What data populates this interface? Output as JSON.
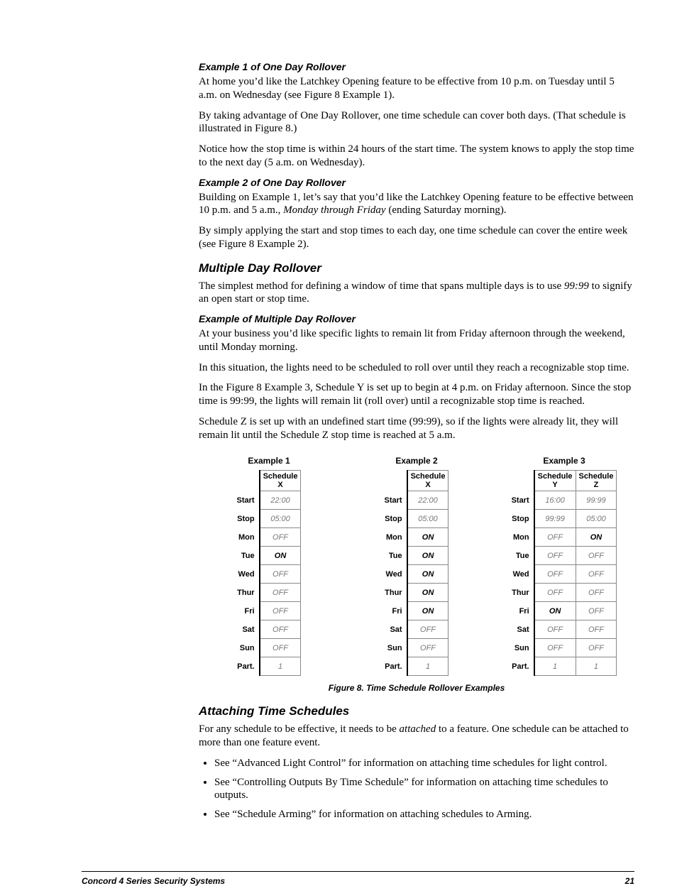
{
  "s1": {
    "h": "Example 1 of One Day Rollover",
    "p1": "At home you’d like the Latchkey Opening feature to be effective from 10 p.m. on Tuesday until 5 a.m. on Wednesday (see Figure 8 Example 1).",
    "p2": "By taking advantage of One Day Rollover, one time schedule can cover both days. (That schedule is illustrated in Figure 8.)",
    "p3": "Notice how the stop time is within 24 hours of the start time. The system knows to apply the stop time to the next day (5 a.m. on Wednesday)."
  },
  "s2": {
    "h": "Example 2 of One Day Rollover",
    "p1a": "Building on Example 1, let’s say that you’d like the Latchkey Opening feature to be effective between 10 p.m. and 5 a.m., ",
    "p1b": "Monday through Friday",
    "p1c": " (ending Saturday morning).",
    "p2": "By simply applying the start and stop times to each day, one time schedule can cover the entire week (see Figure 8 Example 2)."
  },
  "s3": {
    "h": "Multiple Day Rollover",
    "p1a": "The simplest method for defining a window of time that spans multiple days is to use ",
    "p1b": "99:99",
    "p1c": " to signify an open start or stop time."
  },
  "s4": {
    "h": "Example of Multiple Day Rollover",
    "p1": "At your business you’d like specific lights to remain lit from Friday afternoon through the weekend, until Monday morning.",
    "p2": "In this situation, the lights need to be scheduled to roll over until they reach a recognizable stop time.",
    "p3": "In the Figure 8 Example 3, Schedule Y is set up to begin at 4 p.m. on Friday afternoon. Since the stop time is 99:99, the lights will remain lit (roll over) until a recognizable stop time is reached.",
    "p4": "Schedule Z is set up with an undefined start time (99:99), so if the lights were already lit, they will remain lit until the Schedule Z stop time is reached at 5 a.m."
  },
  "rows": [
    "Start",
    "Stop",
    "Mon",
    "Tue",
    "Wed",
    "Thur",
    "Fri",
    "Sat",
    "Sun",
    "Part."
  ],
  "fig": {
    "ex1": {
      "title": "Example 1",
      "cols": [
        "Schedule X"
      ],
      "vals": [
        [
          {
            "t": "22:00",
            "c": "off"
          }
        ],
        [
          {
            "t": "05:00",
            "c": "off"
          }
        ],
        [
          {
            "t": "OFF",
            "c": "off"
          }
        ],
        [
          {
            "t": "ON",
            "c": "on"
          }
        ],
        [
          {
            "t": "OFF",
            "c": "off"
          }
        ],
        [
          {
            "t": "OFF",
            "c": "off"
          }
        ],
        [
          {
            "t": "OFF",
            "c": "off"
          }
        ],
        [
          {
            "t": "OFF",
            "c": "off"
          }
        ],
        [
          {
            "t": "OFF",
            "c": "off"
          }
        ],
        [
          {
            "t": "1",
            "c": "off"
          }
        ]
      ]
    },
    "ex2": {
      "title": "Example 2",
      "cols": [
        "Schedule X"
      ],
      "vals": [
        [
          {
            "t": "22:00",
            "c": "off"
          }
        ],
        [
          {
            "t": "05:00",
            "c": "off"
          }
        ],
        [
          {
            "t": "ON",
            "c": "on"
          }
        ],
        [
          {
            "t": "ON",
            "c": "on"
          }
        ],
        [
          {
            "t": "ON",
            "c": "on"
          }
        ],
        [
          {
            "t": "ON",
            "c": "on"
          }
        ],
        [
          {
            "t": "ON",
            "c": "on"
          }
        ],
        [
          {
            "t": "OFF",
            "c": "off"
          }
        ],
        [
          {
            "t": "OFF",
            "c": "off"
          }
        ],
        [
          {
            "t": "1",
            "c": "off"
          }
        ]
      ]
    },
    "ex3": {
      "title": "Example 3",
      "cols": [
        "Schedule Y",
        "Schedule Z"
      ],
      "vals": [
        [
          {
            "t": "16:00",
            "c": "off"
          },
          {
            "t": "99:99",
            "c": "off"
          }
        ],
        [
          {
            "t": "99:99",
            "c": "off"
          },
          {
            "t": "05:00",
            "c": "off"
          }
        ],
        [
          {
            "t": "OFF",
            "c": "off"
          },
          {
            "t": "ON",
            "c": "on"
          }
        ],
        [
          {
            "t": "OFF",
            "c": "off"
          },
          {
            "t": "OFF",
            "c": "off"
          }
        ],
        [
          {
            "t": "OFF",
            "c": "off"
          },
          {
            "t": "OFF",
            "c": "off"
          }
        ],
        [
          {
            "t": "OFF",
            "c": "off"
          },
          {
            "t": "OFF",
            "c": "off"
          }
        ],
        [
          {
            "t": "ON",
            "c": "on"
          },
          {
            "t": "OFF",
            "c": "off"
          }
        ],
        [
          {
            "t": "OFF",
            "c": "off"
          },
          {
            "t": "OFF",
            "c": "off"
          }
        ],
        [
          {
            "t": "OFF",
            "c": "off"
          },
          {
            "t": "OFF",
            "c": "off"
          }
        ],
        [
          {
            "t": "1",
            "c": "off"
          },
          {
            "t": "1",
            "c": "off"
          }
        ]
      ]
    },
    "caption": "Figure 8. Time Schedule Rollover Examples"
  },
  "s5": {
    "h": "Attaching Time Schedules",
    "p1a": "For any schedule to be effective, it needs to be ",
    "p1b": "attached",
    "p1c": " to a feature. One schedule can be attached to more than one feature event.",
    "b1": "See “Advanced Light Control” for information on attaching time schedules for light control.",
    "b2": "See “Controlling Outputs By Time Schedule” for information on attaching time schedules to outputs.",
    "b3": "See “Schedule Arming” for information on attaching schedules to Arming."
  },
  "footer": {
    "left": "Concord  4 Series Security Systems",
    "right": "21"
  }
}
